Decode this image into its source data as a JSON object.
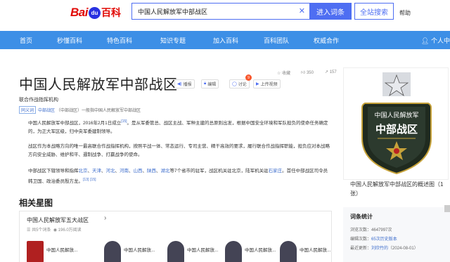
{
  "header": {
    "logo_bai": "Bai",
    "logo_du": "du",
    "logo_baike": "百科",
    "search_value": "中国人民解放军中部战区",
    "clear_icon": "close-icon",
    "enter_button": "进入词条",
    "search_all_button": "全站搜索",
    "help": "帮助"
  },
  "nav": {
    "items": [
      "首页",
      "秒懂百科",
      "特色百科",
      "知识专题",
      "加入百科",
      "百科团队",
      "权威合作"
    ],
    "user": "个人中"
  },
  "entry": {
    "title": "中国人民解放军中部战区",
    "tools": {
      "broadcast": "播报",
      "edit": "编辑",
      "discuss": "讨论",
      "upload_video": "上传视频",
      "discuss_badge": "9"
    },
    "stats": {
      "collect_label": "收藏",
      "likes": "350",
      "shares": "157"
    },
    "subtitle": "联合作战指挥机构",
    "synonym": {
      "tag": "同义词",
      "term": "中部战区",
      "note": "（中部战区）一般指中国人民解放军中部战区"
    },
    "para1": {
      "text": "中国人民解放军中部战区，2016年2月1日成立",
      "ref": "[15]",
      "rest": "。是从军委管总、战区主战、军种主建的总原则出发，根据中国安全环境和军队担负的使命任务确定的，为正大军区级，归中央军委建制领导。"
    },
    "para2": "战区作为本战略方向的唯一最高联合作战指挥机构，按照平战一体、常态运行、专司主营、精干高效的要求，履行联合作战指挥职能，担负应对本战略方向安全威胁、维护和平、遏制战争、打赢战争的使命。",
    "para3": {
      "lead": "中部战区下辖领导和指挥",
      "provinces": [
        "北京",
        "天津",
        "河北",
        "河南",
        "山西",
        "陕西",
        "湖北"
      ],
      "sep": "、",
      "mid": "等7个省市的驻军，战区机关驻北京，陆军机关驻",
      "city": "石家庄",
      "tail": "。首任中部战区司令员韩卫国、政治委员殷方龙。",
      "refs": [
        "[13]",
        "[15]"
      ]
    },
    "section_heading": "相关星图",
    "album": {
      "title": "中国人民解放军五大战区",
      "arrow": "›",
      "count": "共5个词条",
      "views": "196.0万阅读",
      "items": [
        "中国人民解放...",
        "中国人民解放...",
        "中国人民解放...",
        "中国人民解放...",
        "中国人民解放..."
      ]
    }
  },
  "sidebar": {
    "badge_line1": "中国人民解放军",
    "badge_line2": "中部战区",
    "caption": "中国人民解放军中部战区的概述图（1张）",
    "stats_heading": "词条统计",
    "views_label": "浏览次数：",
    "views_value": "4647997次",
    "edits_label": "编辑次数：",
    "edits_value": "65次历史版本",
    "recent_label": "最近更新：",
    "recent_user": "刘欣竹的",
    "recent_date": "（2024-08-01）"
  },
  "colors": {
    "brand_blue": "#4e6ef2",
    "nav_blue": "#3d8fe6",
    "logo_red": "#e10602",
    "link_blue": "#3d6dcc",
    "badge_orange": "#f8562c"
  }
}
